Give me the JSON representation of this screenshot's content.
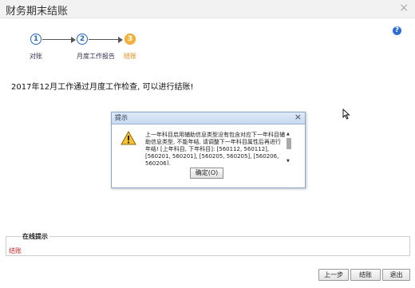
{
  "window": {
    "title": "财务期末结账",
    "close_symbol": "×"
  },
  "help_icon_symbol": "?",
  "steps": [
    {
      "number": "1",
      "label": "对账",
      "state": "done"
    },
    {
      "number": "2",
      "label": "月度工作报告",
      "state": "done"
    },
    {
      "number": "3",
      "label": "结账",
      "state": "current"
    }
  ],
  "main": {
    "message": "2017年12月工作通过月度工作检查, 可以进行结账!"
  },
  "dialog": {
    "title": "提示",
    "close_symbol": "×",
    "text": "上一年科目启用辅助信息类型没有包含对应下一年科目辅助信息类型, 不能年结, 请调整下一年科目属性后再进行年结! [上年科目, 下年科目]: [560112, 560112], [560201, 560201], [560205, 560205], [560206, 560206],",
    "ok_label": "确定(O)"
  },
  "online_hint": {
    "label": "在线提示",
    "text": "结账"
  },
  "footer": {
    "prev_label": "上一步",
    "close_label": "结账",
    "exit_label": "退出"
  }
}
